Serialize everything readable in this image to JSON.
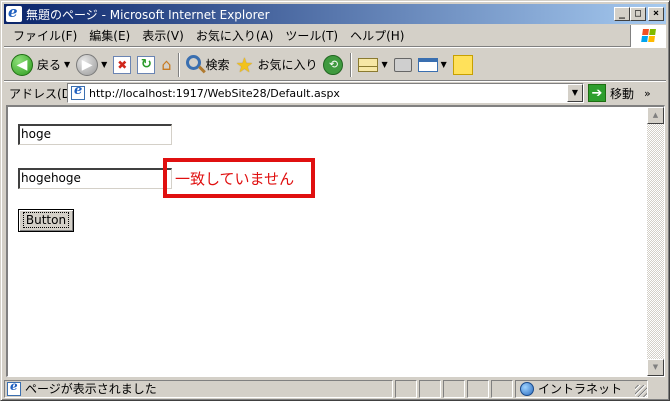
{
  "window": {
    "title": "無題のページ - Microsoft Internet Explorer",
    "controls": {
      "minimize": "_",
      "maximize": "□",
      "close": "×"
    }
  },
  "menu": {
    "items": [
      "ファイル(F)",
      "編集(E)",
      "表示(V)",
      "お気に入り(A)",
      "ツール(T)",
      "ヘルプ(H)"
    ]
  },
  "toolbar": {
    "back_label": "戻る",
    "search_label": "検索",
    "favorites_label": "お気に入り",
    "icons": [
      "back-arrow-icon",
      "forward-arrow-icon",
      "stop-icon",
      "refresh-icon",
      "home-icon",
      "search-icon",
      "favorites-star-icon",
      "history-icon",
      "mail-icon",
      "print-icon",
      "edit-icon",
      "note-icon"
    ]
  },
  "address": {
    "label": "アドレス(D)",
    "url": "http://localhost:1917/WebSite28/Default.aspx",
    "go_label": "移動",
    "links_chevron": "»"
  },
  "content": {
    "textbox1_value": "hoge",
    "textbox2_value": "hogehoge",
    "validation_message": "一致していません",
    "button_label": "Button"
  },
  "status": {
    "text": "ページが表示されました",
    "zone": "イントラネット"
  },
  "colors": {
    "title_gradient_start": "#0a246a",
    "title_gradient_end": "#a6caf0",
    "chrome": "#d4d0c8",
    "error_red": "#e01010"
  }
}
